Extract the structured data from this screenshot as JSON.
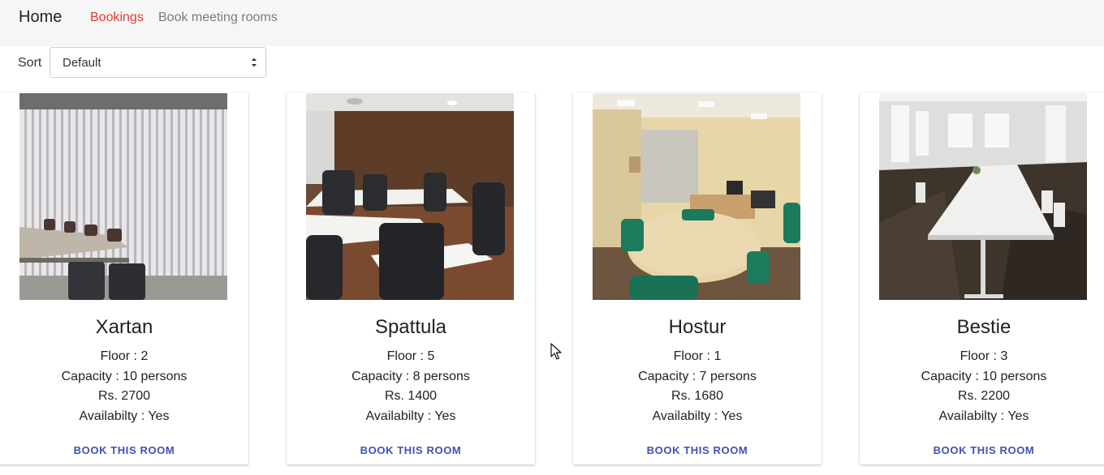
{
  "nav": {
    "home": "Home",
    "bookings": "Bookings",
    "book_rooms": "Book meeting rooms"
  },
  "sort": {
    "label": "Sort",
    "selected": "Default"
  },
  "rooms": [
    {
      "name": "Xartan",
      "floor": "Floor : 2",
      "capacity": "Capacity : 10 persons",
      "price": "Rs. 2700",
      "availability": "Availabilty : Yes",
      "button": "BOOK THIS ROOM"
    },
    {
      "name": "Spattula",
      "floor": "Floor : 5",
      "capacity": "Capacity : 8 persons",
      "price": "Rs. 1400",
      "availability": "Availabilty : Yes",
      "button": "BOOK THIS ROOM"
    },
    {
      "name": "Hostur",
      "floor": "Floor : 1",
      "capacity": "Capacity : 7 persons",
      "price": "Rs. 1680",
      "availability": "Availabilty : Yes",
      "button": "BOOK THIS ROOM"
    },
    {
      "name": "Bestie",
      "floor": "Floor : 3",
      "capacity": "Capacity : 10 persons",
      "price": "Rs. 2200",
      "availability": "Availabilty : Yes",
      "button": "BOOK THIS ROOM"
    }
  ],
  "colors": {
    "active_nav": "#e53935",
    "button_text": "#3f51b5",
    "navbar_bg": "#f5f6f5"
  }
}
